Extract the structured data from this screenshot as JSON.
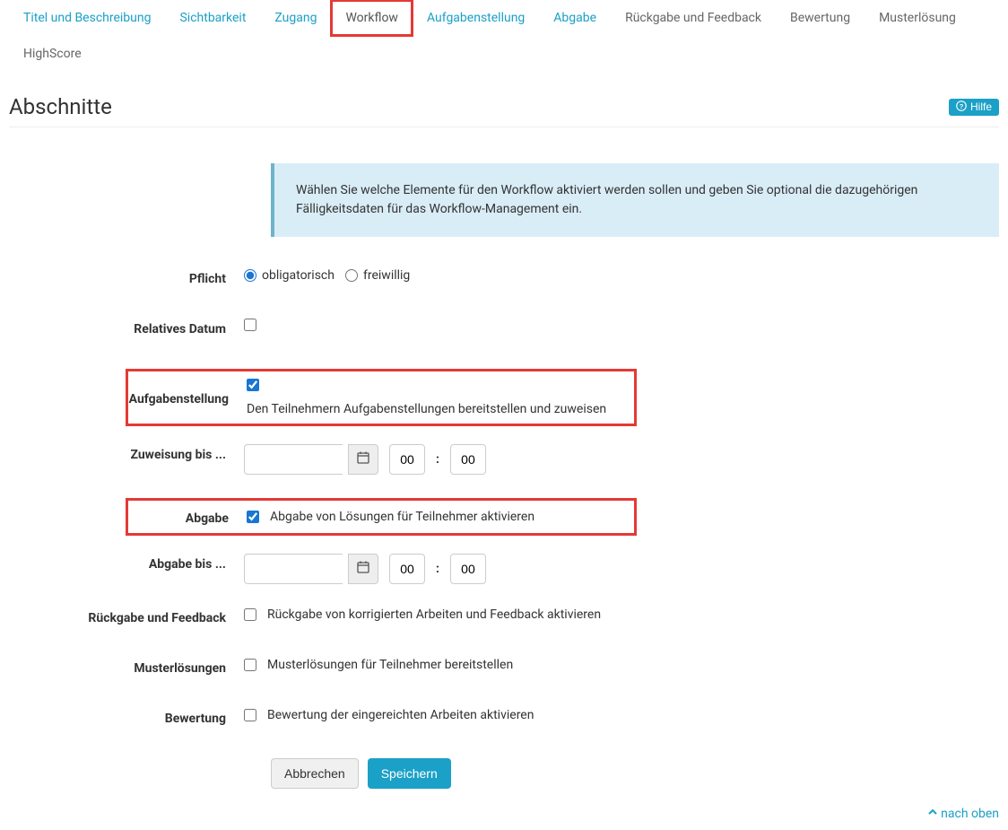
{
  "tabs": {
    "titel": "Titel und Beschreibung",
    "sichtbarkeit": "Sichtbarkeit",
    "zugang": "Zugang",
    "workflow": "Workflow",
    "aufgabenstellung": "Aufgabenstellung",
    "abgabe": "Abgabe",
    "rueckgabe": "Rückgabe und Feedback",
    "bewertung": "Bewertung",
    "musterloesung": "Musterlösung",
    "highscore": "HighScore"
  },
  "heading": "Abschnitte",
  "help_label": "Hilfe",
  "info_text": "Wählen Sie welche Elemente für den Workflow aktiviert werden sollen und geben Sie optional die dazugehörigen Fälligkeitsdaten für das Workflow-Management ein.",
  "fields": {
    "pflicht": {
      "label": "Pflicht",
      "opt_obligatorisch": "obligatorisch",
      "opt_freiwillig": "freiwillig"
    },
    "relatives_datum": {
      "label": "Relatives Datum"
    },
    "aufgabenstellung": {
      "label": "Aufgabenstellung",
      "desc": "Den Teilnehmern Aufgabenstellungen bereitstellen und zuweisen"
    },
    "zuweisung_bis": {
      "label": "Zuweisung bis ...",
      "date_value": "",
      "hh": "00",
      "mm": "00"
    },
    "abgabe": {
      "label": "Abgabe",
      "desc": "Abgabe von Lösungen für Teilnehmer aktivieren"
    },
    "abgabe_bis": {
      "label": "Abgabe bis ...",
      "date_value": "",
      "hh": "00",
      "mm": "00"
    },
    "rueckgabe": {
      "label": "Rückgabe und Feedback",
      "desc": "Rückgabe von korrigierten Arbeiten und Feedback aktivieren"
    },
    "musterloesungen": {
      "label": "Musterlösungen",
      "desc": "Musterlösungen für Teilnehmer bereitstellen"
    },
    "bewertung": {
      "label": "Bewertung",
      "desc": "Bewertung der eingereichten Arbeiten aktivieren"
    }
  },
  "buttons": {
    "cancel": "Abbrechen",
    "save": "Speichern"
  },
  "bottom_link": "nach oben"
}
